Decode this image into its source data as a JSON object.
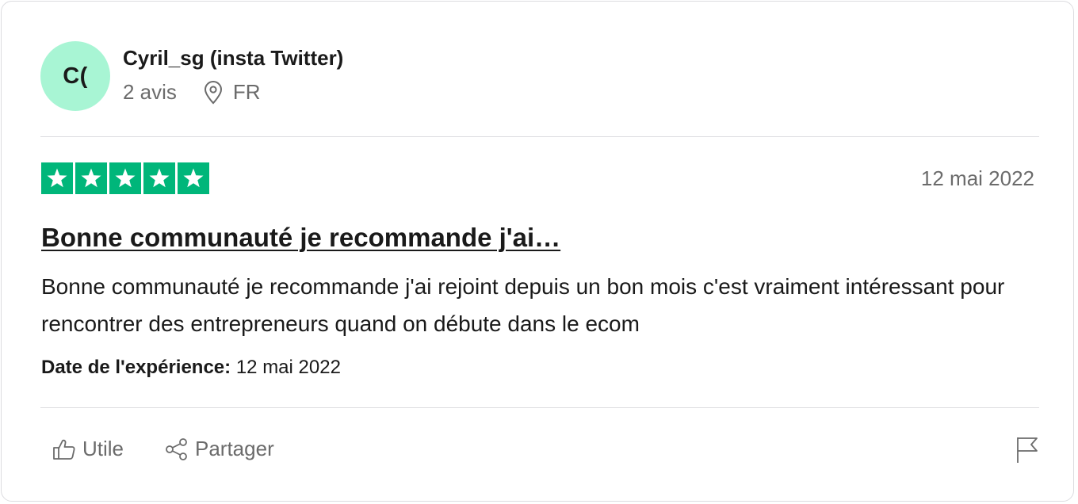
{
  "author": {
    "initials": "C(",
    "name": "Cyril_sg (insta Twitter)",
    "reviews_count": "2 avis",
    "country": "FR",
    "avatar_color": "#a8f5d4"
  },
  "review": {
    "rating": 5,
    "max_rating": 5,
    "star_color": "#00b67a",
    "date": "12 mai 2022",
    "title": "Bonne communauté je recommande j'ai…",
    "text": "Bonne communauté je recommande j'ai rejoint depuis un bon mois c'est vraiment intéressant pour rencontrer des entrepreneurs quand on débute dans le ecom",
    "experience_label": "Date de l'expérience:",
    "experience_date": "12 mai 2022"
  },
  "actions": {
    "useful_label": "Utile",
    "useful_icon": "thumbs-up-icon",
    "share_label": "Partager",
    "share_icon": "share-icon",
    "flag_icon": "flag-icon"
  }
}
